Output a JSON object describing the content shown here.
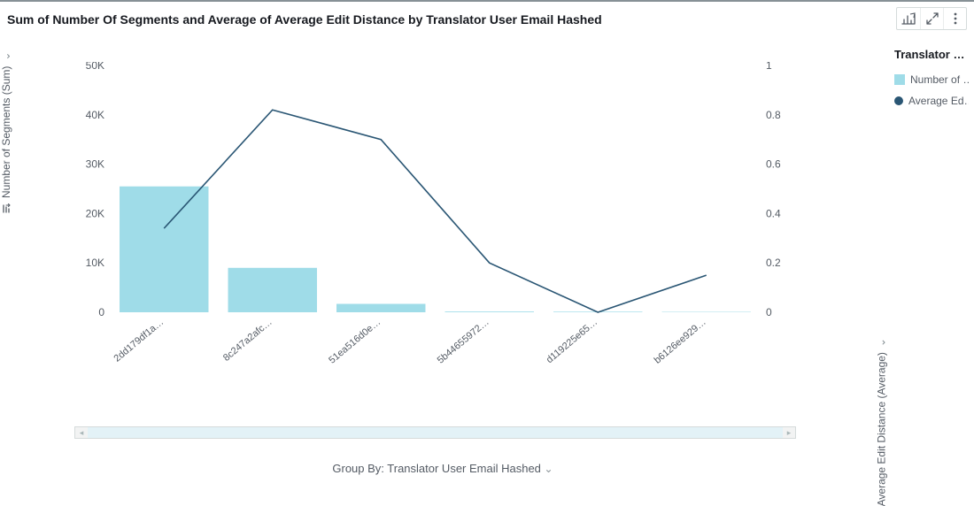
{
  "title": "Sum of Number Of Segments and Average of Average Edit Distance by Translator User Email Hashed",
  "toolbar": {
    "insight_icon": "chart-insight-icon",
    "expand_icon": "expand-icon",
    "menu_icon": "kebab-menu-icon"
  },
  "legend": {
    "title": "Translator …",
    "items": [
      {
        "label": "Number of …",
        "kind": "square",
        "color": "#9fdce8"
      },
      {
        "label": "Average Ed…",
        "kind": "dot",
        "color": "#2a5674"
      }
    ]
  },
  "axes": {
    "y_left": {
      "label": "Number of Segments (Sum)",
      "ticks": [
        "0",
        "10K",
        "20K",
        "30K",
        "40K",
        "50K"
      ],
      "range": [
        0,
        50000
      ]
    },
    "y_right": {
      "label": "Average Edit Distance (Average)",
      "ticks": [
        "0",
        "0.2",
        "0.4",
        "0.6",
        "0.8",
        "1"
      ],
      "range": [
        0,
        1
      ]
    },
    "x": {
      "caption": "Group By: Translator User Email Hashed"
    }
  },
  "chart_data": {
    "type": "bar",
    "categories": [
      "2dd179df1a…",
      "8c247a2afc…",
      "51ea516d0e…",
      "5b44655972…",
      "d119225e65…",
      "b6126ee929…"
    ],
    "series": [
      {
        "name": "Number of Segments (Sum)",
        "axis": "left",
        "kind": "bar",
        "values": [
          25500,
          9000,
          1700,
          150,
          120,
          80
        ]
      },
      {
        "name": "Average Edit Distance (Average)",
        "axis": "right",
        "kind": "line",
        "values": [
          0.34,
          0.82,
          0.7,
          0.2,
          0.0,
          0.15
        ]
      }
    ],
    "title": "Sum of Number Of Segments and Average of Average Edit Distance by Translator User Email Hashed",
    "xlabel": "Group By: Translator User Email Hashed",
    "ylabel_left": "Number of Segments (Sum)",
    "ylabel_right": "Average Edit Distance (Average)",
    "ylim_left": [
      0,
      50000
    ],
    "ylim_right": [
      0,
      1
    ]
  }
}
